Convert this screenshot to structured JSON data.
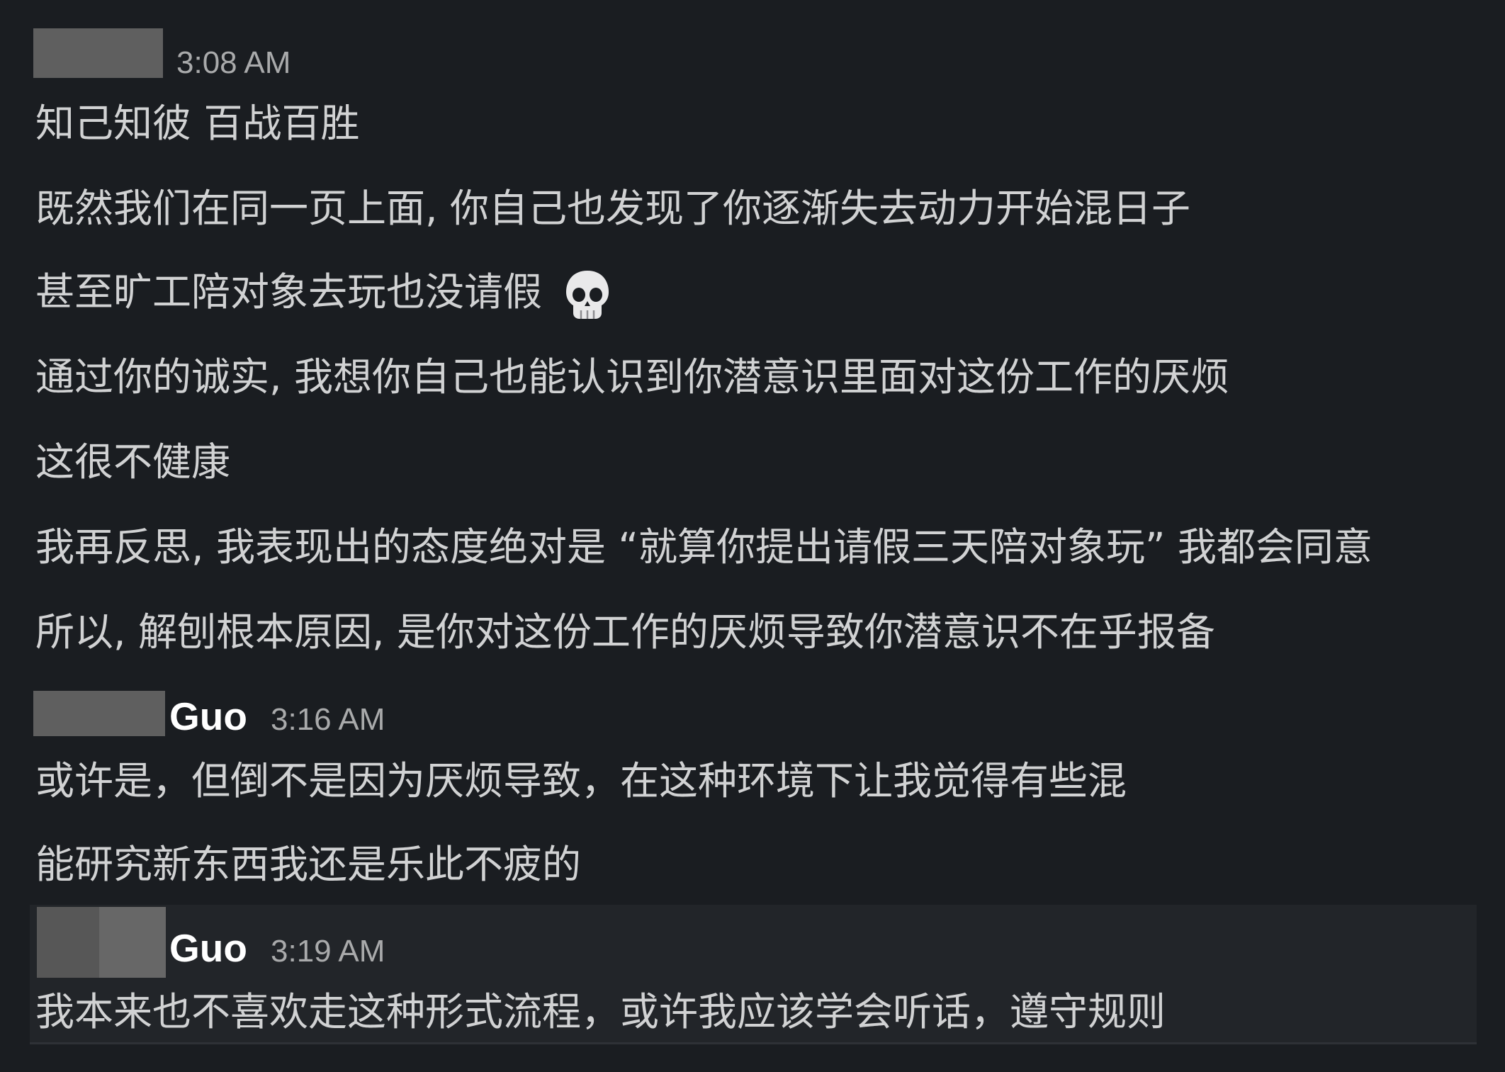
{
  "messages": [
    {
      "author": "",
      "time": "3:08 AM",
      "lines": [
        "知己知彼 百战百胜",
        "既然我们在同一页上面, 你自己也发现了你逐渐失去动力开始混日子",
        "甚至旷工陪对象去玩也没请假",
        "通过你的诚实, 我想你自己也能认识到你潜意识里面对这份工作的厌烦",
        "这很不健康",
        "我再反思, 我表现出的态度绝对是 “就算你提出请假三天陪对象玩” 我都会同意",
        "所以, 解刨根本原因, 是你对这份工作的厌烦导致你潜意识不在乎报备"
      ],
      "emoji": "skull-emoji"
    },
    {
      "author": "Guo",
      "time": "3:16 AM",
      "lines": [
        "或许是，但倒不是因为厌烦导致，在这种环境下让我觉得有些混",
        "能研究新东西我还是乐此不疲的"
      ]
    },
    {
      "author": "Guo",
      "time": "3:19 AM",
      "lines": [
        "我本来也不喜欢走这种形式流程，或许我应该学会听话，遵守规则"
      ]
    }
  ],
  "colors": {
    "background": "#1a1d21",
    "hover_background": "#222529",
    "text": "#d1d2d3",
    "timestamp": "#a9aaab",
    "name": "#ffffff",
    "redaction": "#5f5f5f"
  }
}
